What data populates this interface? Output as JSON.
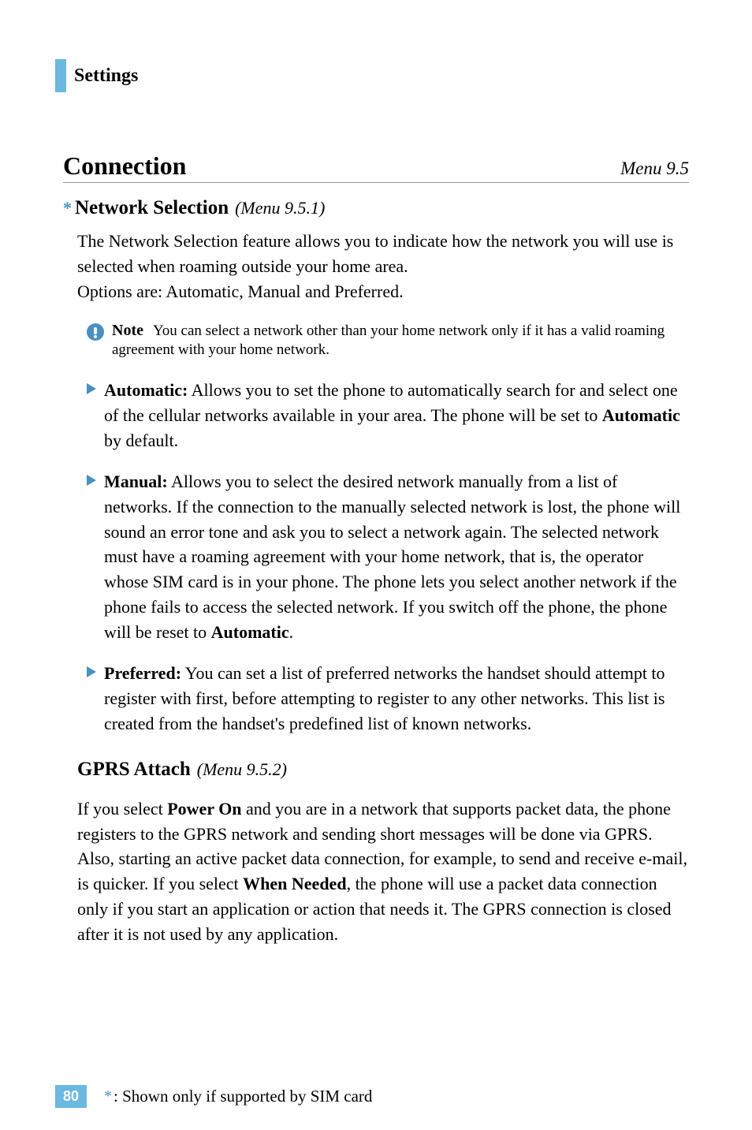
{
  "header": {
    "section_title": "Settings"
  },
  "connection": {
    "title": "Connection",
    "menu_ref": "Menu 9.5"
  },
  "network_selection": {
    "asterisk": "*",
    "title": "Network Selection",
    "menu_ref": "(Menu 9.5.1)",
    "intro_line1": "The Network Selection feature allows you to indicate how the network you will use is selected when roaming outside your home area.",
    "intro_line2": "Options are: Automatic, Manual and Preferred.",
    "note_label": "Note",
    "note_text": "You can select a network other than your home network only if it has a valid roaming agreement with your home network.",
    "bullets": [
      {
        "label": "Automatic:",
        "pre": " Allows you to set the phone to automatically search for and select one of the cellular networks available in your area. The phone will be set to ",
        "bold1": "Automatic",
        "post": " by default."
      },
      {
        "label": "Manual:",
        "pre": " Allows you to select the desired network manually from a list of networks. If the connection to the manually selected network is lost, the phone will sound an error tone and ask you to select a network again. The selected network must have a roaming agreement with your home network, that is, the operator whose SIM card is in your phone. The phone lets you select another network if the phone fails to access the selected network. If you switch off the phone, the phone will be reset to ",
        "bold1": "Automatic",
        "post": "."
      },
      {
        "label": "Preferred:",
        "pre": " You can set a list of preferred networks the handset should attempt to register with first, before attempting to register to any other networks. This list is created from the handset's predefined list of known networks.",
        "bold1": "",
        "post": ""
      }
    ]
  },
  "gprs": {
    "title": "GPRS Attach",
    "menu_ref": "(Menu 9.5.2)",
    "text_pre": "If you select ",
    "bold_power": "Power On",
    "text_mid": " and you are in a network that supports packet data, the phone registers to the GPRS network and sending short messages will be done via GPRS. Also, starting an active packet data connection, for example, to send and receive e-mail, is quicker. If you select ",
    "bold_when": "When Needed",
    "text_post": ", the phone will use a packet data connection only if you start an application or action that needs it. The GPRS connection is closed after it is not used by any application."
  },
  "footer": {
    "page_number": "80",
    "asterisk": "*",
    "text": ": Shown only if supported by SIM card"
  }
}
